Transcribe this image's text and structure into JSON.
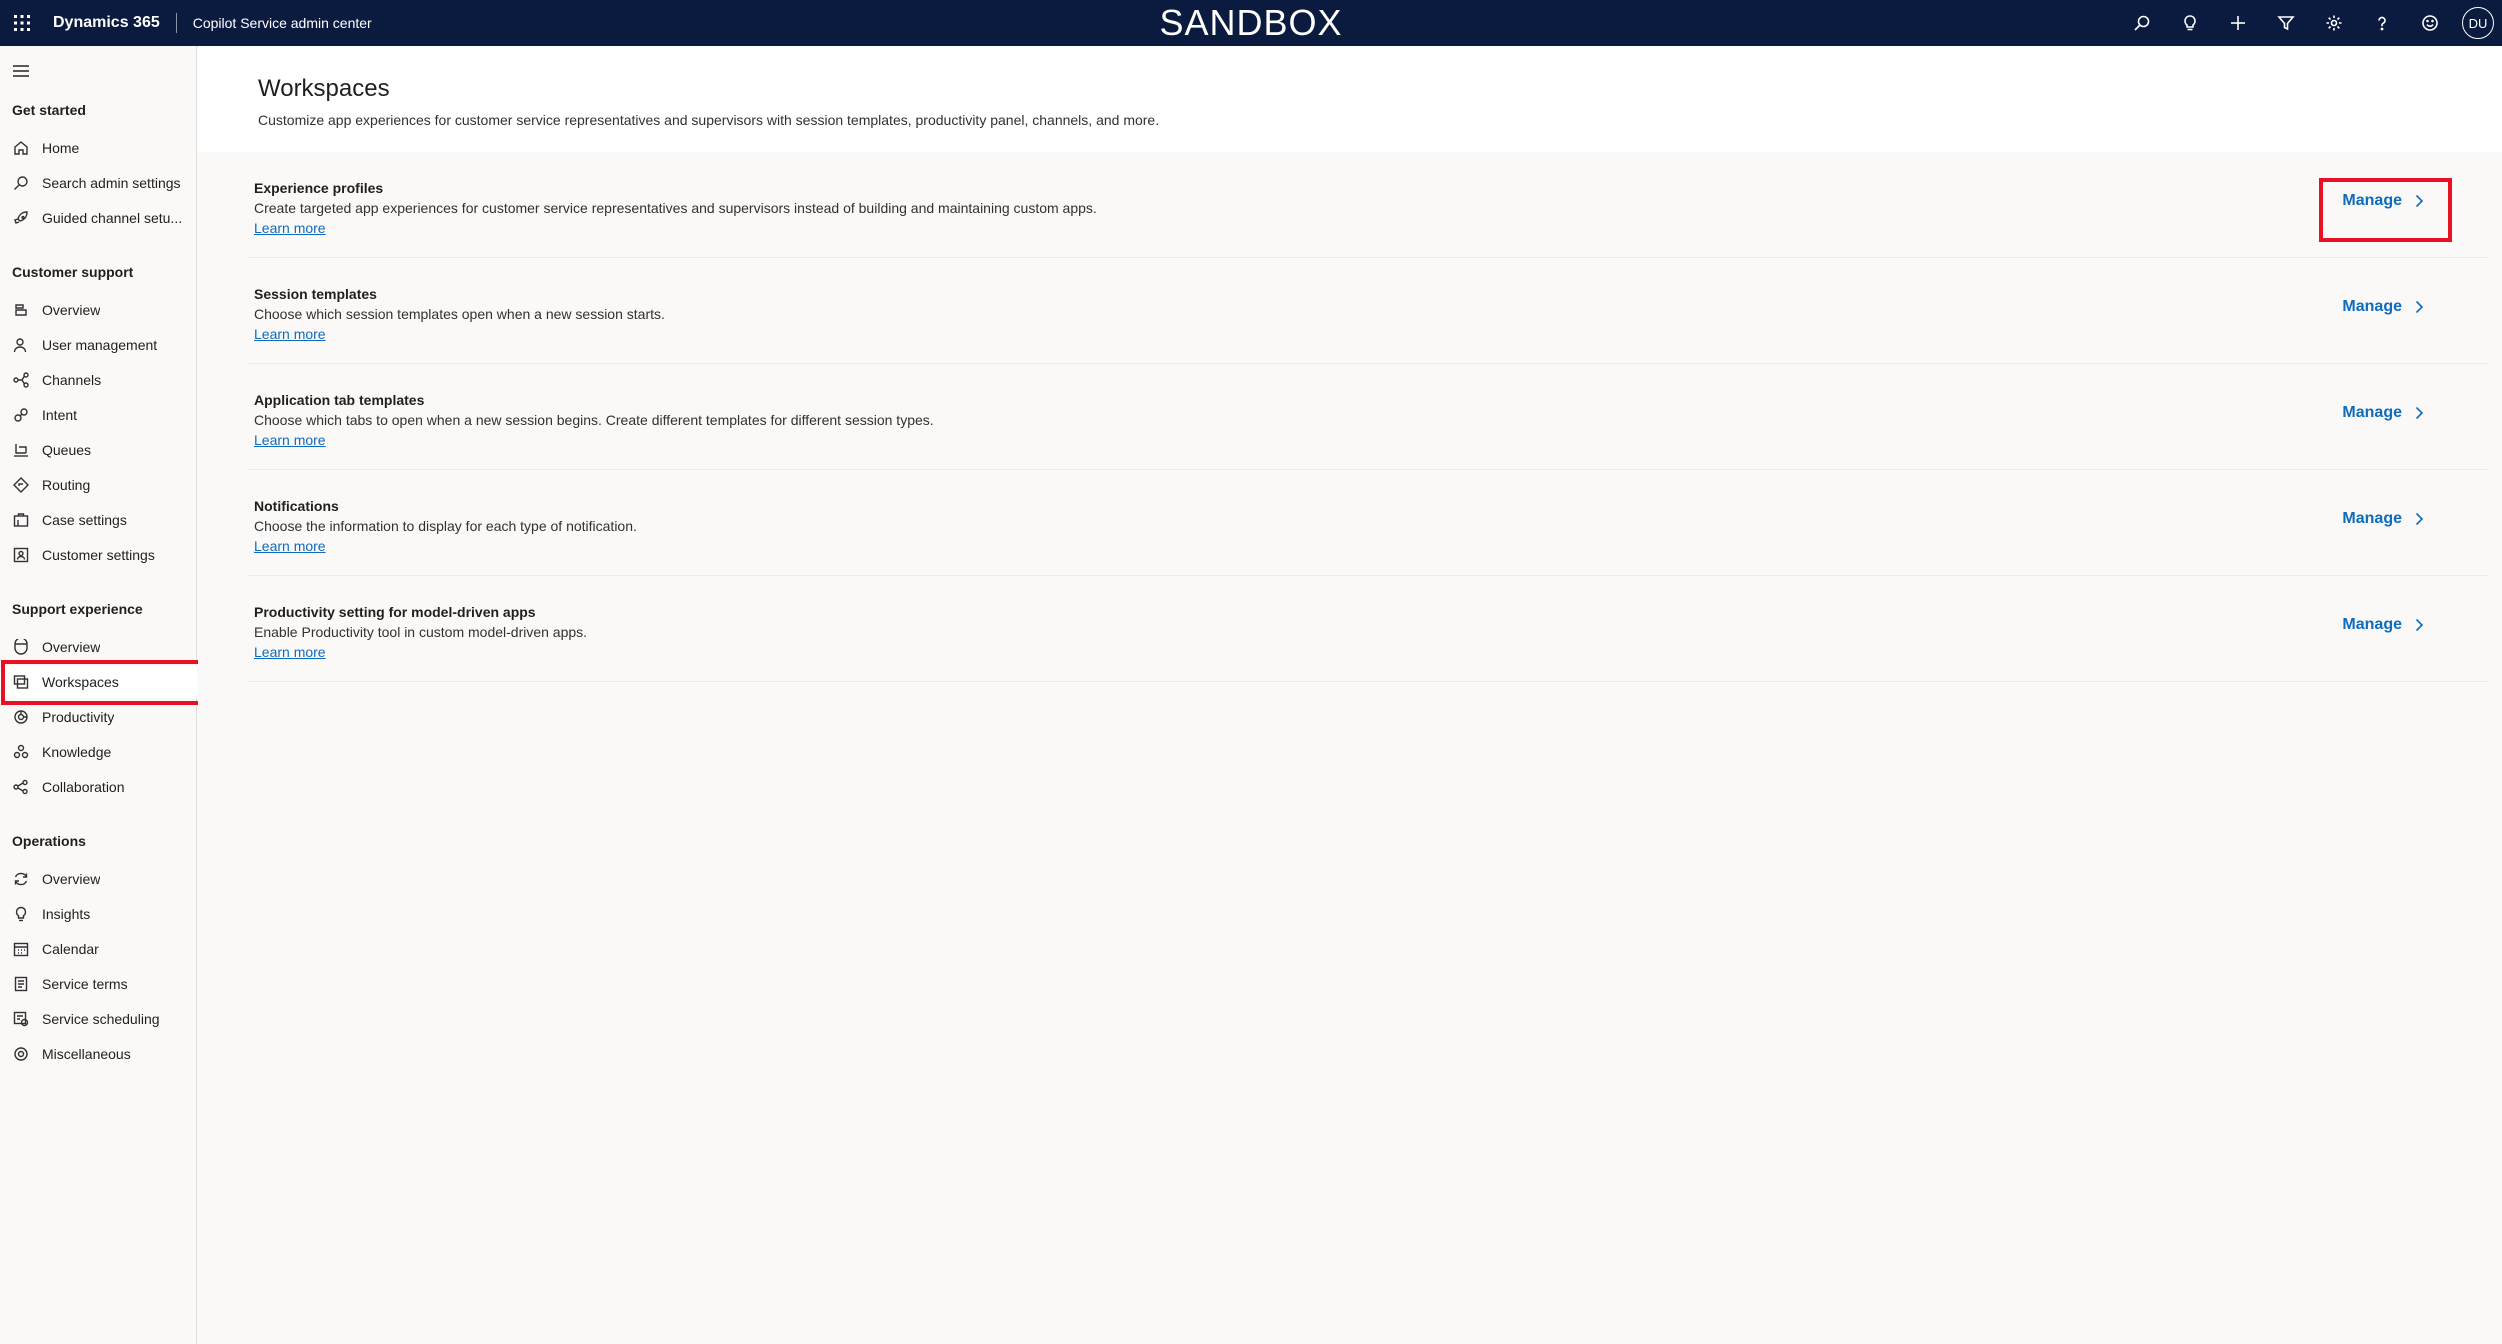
{
  "topbar": {
    "brand": "Dynamics 365",
    "app_name": "Copilot Service admin center",
    "environment": "SANDBOX",
    "avatar_initials": "DU",
    "icons": [
      "search-icon",
      "lightbulb-icon",
      "plus-icon",
      "filter-icon",
      "gear-icon",
      "help-icon",
      "smiley-icon"
    ]
  },
  "sidebar": {
    "sections": [
      {
        "title": "Get started",
        "items": [
          {
            "label": "Home",
            "icon": "home-icon"
          },
          {
            "label": "Search admin settings",
            "icon": "search-icon"
          },
          {
            "label": "Guided channel setu...",
            "icon": "rocket-icon"
          }
        ]
      },
      {
        "title": "Customer support",
        "items": [
          {
            "label": "Overview",
            "icon": "overview-icon"
          },
          {
            "label": "User management",
            "icon": "user-icon"
          },
          {
            "label": "Channels",
            "icon": "channels-icon"
          },
          {
            "label": "Intent",
            "icon": "intent-icon"
          },
          {
            "label": "Queues",
            "icon": "queues-icon"
          },
          {
            "label": "Routing",
            "icon": "routing-icon"
          },
          {
            "label": "Case settings",
            "icon": "case-icon"
          },
          {
            "label": "Customer settings",
            "icon": "customer-icon"
          }
        ]
      },
      {
        "title": "Support experience",
        "items": [
          {
            "label": "Overview",
            "icon": "overview-icon"
          },
          {
            "label": "Workspaces",
            "icon": "workspaces-icon"
          },
          {
            "label": "Productivity",
            "icon": "productivity-icon"
          },
          {
            "label": "Knowledge",
            "icon": "knowledge-icon"
          },
          {
            "label": "Collaboration",
            "icon": "collaboration-icon"
          }
        ]
      },
      {
        "title": "Operations",
        "items": [
          {
            "label": "Overview",
            "icon": "refresh-icon"
          },
          {
            "label": "Insights",
            "icon": "lightbulb-icon"
          },
          {
            "label": "Calendar",
            "icon": "calendar-icon"
          },
          {
            "label": "Service terms",
            "icon": "terms-icon"
          },
          {
            "label": "Service scheduling",
            "icon": "scheduling-icon"
          },
          {
            "label": "Miscellaneous",
            "icon": "gear-icon"
          }
        ]
      }
    ],
    "selected": "Workspaces"
  },
  "main": {
    "title": "Workspaces",
    "description": "Customize app experiences for customer service representatives and supervisors with session templates, productivity panel, channels, and more.",
    "cards": [
      {
        "title": "Experience profiles",
        "description": "Create targeted app experiences for customer service representatives and supervisors instead of building and maintaining custom apps.",
        "link": "Learn more",
        "action": "Manage"
      },
      {
        "title": "Session templates",
        "description": "Choose which session templates open when a new session starts.",
        "link": "Learn more",
        "action": "Manage"
      },
      {
        "title": "Application tab templates",
        "description": "Choose which tabs to open when a new session begins. Create different templates for different session types.",
        "link": "Learn more",
        "action": "Manage"
      },
      {
        "title": "Notifications",
        "description": "Choose the information to display for each type of notification.",
        "link": "Learn more",
        "action": "Manage"
      },
      {
        "title": "Productivity setting for model-driven apps",
        "description": "Enable Productivity tool in custom model-driven apps.",
        "link": "Learn more",
        "action": "Manage"
      }
    ]
  },
  "highlight_color": "#e81123",
  "accent_color": "#0f6cbd"
}
